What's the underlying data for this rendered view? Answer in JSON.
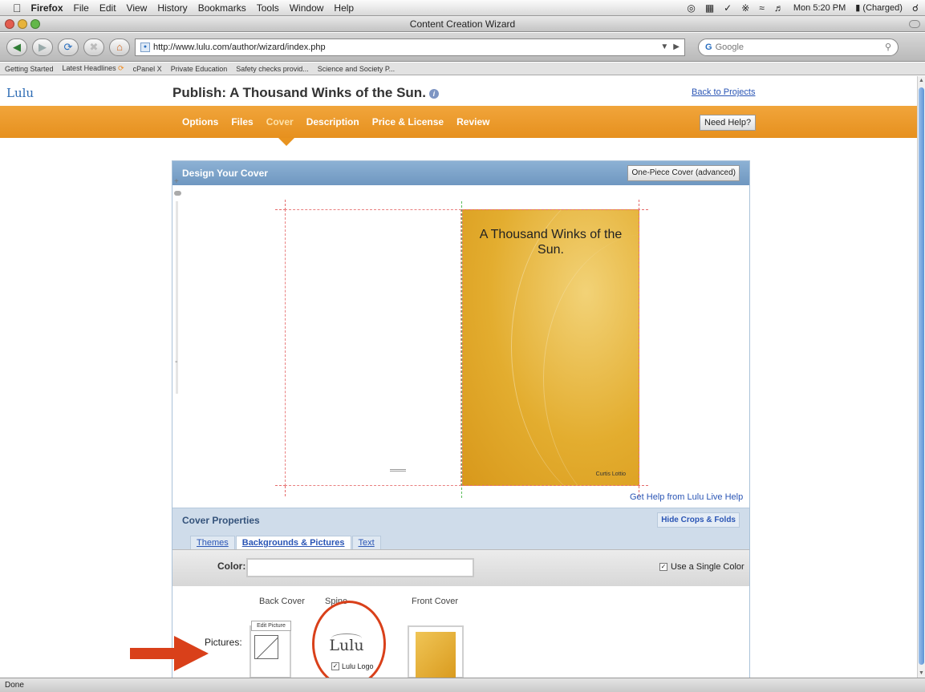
{
  "menubar": {
    "app": "Firefox",
    "items": [
      "File",
      "Edit",
      "View",
      "History",
      "Bookmarks",
      "Tools",
      "Window",
      "Help"
    ],
    "clock": "Mon 5:20 PM",
    "battery": "(Charged)"
  },
  "window": {
    "title": "Content Creation Wizard"
  },
  "toolbar": {
    "url": "http://www.lulu.com/author/wizard/index.php",
    "search_placeholder": "Google"
  },
  "bookmarks": [
    "Getting Started",
    "Latest Headlines",
    "cPanel X",
    "Private Education",
    "Safety checks provid...",
    "Science and Society P..."
  ],
  "page": {
    "logo": "Lulu",
    "title": "Publish: A Thousand Winks of the Sun.",
    "back_to_projects": "Back to Projects",
    "tabs": [
      "Options",
      "Files",
      "Cover",
      "Description",
      "Price & License",
      "Review"
    ],
    "active_tab": "Cover",
    "need_help": "Need Help?",
    "design": {
      "heading": "Design Your Cover",
      "one_piece": "One-Piece Cover (advanced)",
      "cover_title": "A Thousand Winks of the Sun.",
      "cover_author": "Curtis Lottio",
      "live_help": "Get Help from Lulu Live Help"
    },
    "properties": {
      "heading": "Cover Properties",
      "hide_crops": "Hide Crops & Folds",
      "subtabs": [
        "Themes",
        "Backgrounds & Pictures",
        "Text"
      ],
      "active_subtab": "Backgrounds & Pictures",
      "color_label": "Color:",
      "color_value": "",
      "single_color": "Use a Single Color",
      "single_color_checked": true,
      "back_cover": "Back Cover",
      "spine": "Spine",
      "front_cover": "Front Cover",
      "pictures_label": "Pictures:",
      "edit_picture": "Edit Picture",
      "spine_logo": "Lulu",
      "lulu_logo_label": "Lulu Logo",
      "lulu_logo_checked": true
    }
  },
  "status": "Done",
  "colors": {
    "orange": "#e8931f",
    "blue_link": "#2a55b5",
    "panel_blue": "#7ea4ca",
    "annotation_red": "#d9401a"
  }
}
